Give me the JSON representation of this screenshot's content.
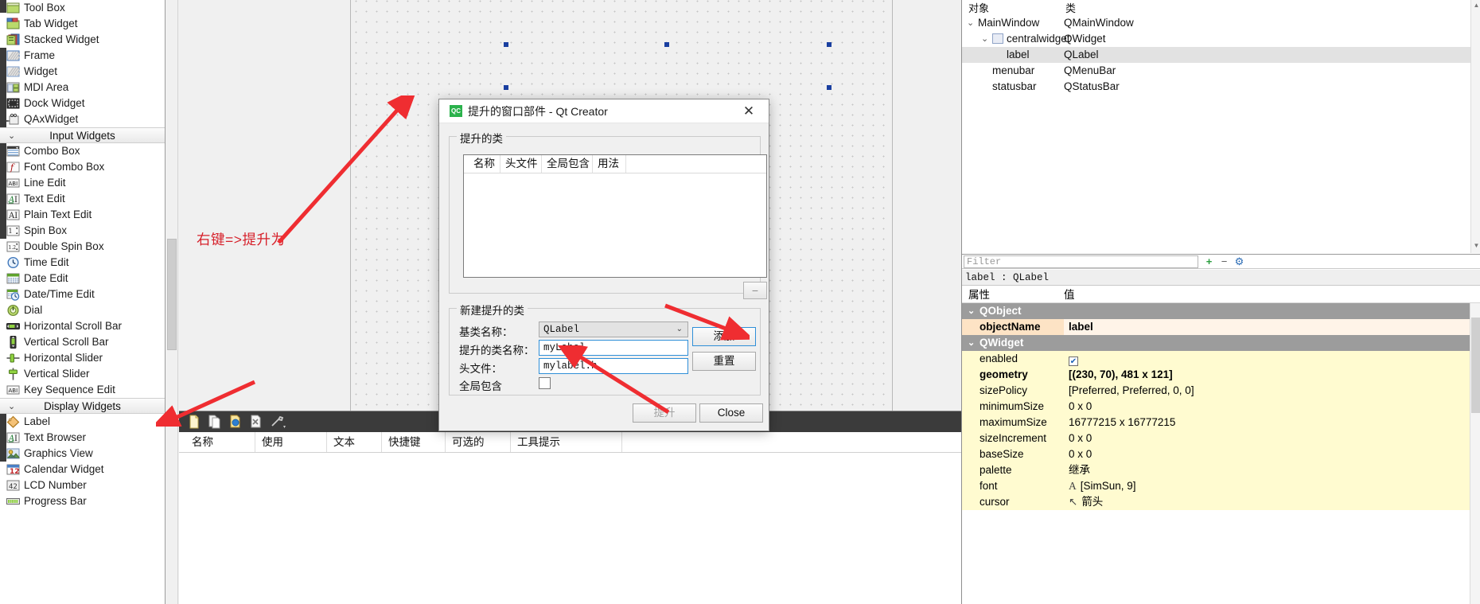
{
  "widget_box": {
    "groups": [
      {
        "items": [
          {
            "label": "Tool Box",
            "icon": "toolbox-icon"
          },
          {
            "label": "Tab Widget",
            "icon": "tabwidget-icon"
          },
          {
            "label": "Stacked Widget",
            "icon": "stackedwidget-icon"
          },
          {
            "label": "Frame",
            "icon": "frame-icon"
          },
          {
            "label": "Widget",
            "icon": "widget-icon"
          },
          {
            "label": "MDI Area",
            "icon": "mdiarea-icon"
          },
          {
            "label": "Dock Widget",
            "icon": "dockwidget-icon"
          },
          {
            "label": "QAxWidget",
            "icon": "qaxwidget-icon"
          }
        ]
      },
      {
        "title": "Input Widgets",
        "items": [
          {
            "label": "Combo Box",
            "icon": "combobox-icon"
          },
          {
            "label": "Font Combo Box",
            "icon": "fontcombobox-icon"
          },
          {
            "label": "Line Edit",
            "icon": "lineedit-icon"
          },
          {
            "label": "Text Edit",
            "icon": "textedit-icon"
          },
          {
            "label": "Plain Text Edit",
            "icon": "plaintextedit-icon"
          },
          {
            "label": "Spin Box",
            "icon": "spinbox-icon"
          },
          {
            "label": "Double Spin Box",
            "icon": "doublespinbox-icon"
          },
          {
            "label": "Time Edit",
            "icon": "timeedit-icon"
          },
          {
            "label": "Date Edit",
            "icon": "dateedit-icon"
          },
          {
            "label": "Date/Time Edit",
            "icon": "datetimeedit-icon"
          },
          {
            "label": "Dial",
            "icon": "dial-icon"
          },
          {
            "label": "Horizontal Scroll Bar",
            "icon": "hscrollbar-icon"
          },
          {
            "label": "Vertical Scroll Bar",
            "icon": "vscrollbar-icon"
          },
          {
            "label": "Horizontal Slider",
            "icon": "hslider-icon"
          },
          {
            "label": "Vertical Slider",
            "icon": "vslider-icon"
          },
          {
            "label": "Key Sequence Edit",
            "icon": "keysequenceedit-icon"
          }
        ]
      },
      {
        "title": "Display Widgets",
        "items": [
          {
            "label": "Label",
            "icon": "label-icon"
          },
          {
            "label": "Text Browser",
            "icon": "textbrowser-icon"
          },
          {
            "label": "Graphics View",
            "icon": "graphicsview-icon"
          },
          {
            "label": "Calendar Widget",
            "icon": "calendarwidget-icon"
          },
          {
            "label": "LCD Number",
            "icon": "lcdnumber-icon"
          },
          {
            "label": "Progress Bar",
            "icon": "progressbar-icon"
          }
        ]
      }
    ]
  },
  "annotations": {
    "hint_text": "右键=>提升为",
    "hint_color": "#d6202a"
  },
  "dialog": {
    "title": "提升的窗口部件 - Qt Creator",
    "app_icon_text": "QC",
    "close_label": "✕",
    "promoted_group": {
      "legend": "提升的类",
      "columns": [
        "名称",
        "头文件",
        "全局包含",
        "用法"
      ],
      "rows": [],
      "remove_button": "−"
    },
    "new_group": {
      "legend": "新建提升的类",
      "fields": [
        {
          "label": "基类名称：",
          "value": "QLabel",
          "type": "combo"
        },
        {
          "label": "提升的类名称：",
          "value": "myLabel",
          "type": "text"
        },
        {
          "label": "头文件：",
          "value": "mylabel.h",
          "type": "text"
        },
        {
          "label": "全局包含",
          "value": "",
          "type": "checkbox",
          "checked": false
        }
      ]
    },
    "buttons": {
      "add": "添加",
      "reset": "重置",
      "promote": "提升",
      "close": "Close"
    }
  },
  "action_editor": {
    "columns": [
      "名称",
      "使用",
      "文本",
      "快捷键",
      "可选的",
      "工具提示"
    ],
    "toolbar_icons": [
      "new-action-icon",
      "copy-action-icon",
      "edit-action-icon",
      "delete-action-icon",
      "configure-icon"
    ],
    "rows": []
  },
  "object_inspector": {
    "headers": [
      "对象",
      "类"
    ],
    "rows": [
      {
        "name": "MainWindow",
        "class": "QMainWindow",
        "indent": 0,
        "expanded": true,
        "selected": false,
        "has_icon": false
      },
      {
        "name": "centralwidget",
        "class": "QWidget",
        "indent": 1,
        "expanded": true,
        "selected": false,
        "has_icon": true
      },
      {
        "name": "label",
        "class": "QLabel",
        "indent": 2,
        "expanded": false,
        "selected": true,
        "has_icon": false
      },
      {
        "name": "menubar",
        "class": "QMenuBar",
        "indent": 1,
        "expanded": false,
        "selected": false,
        "has_icon": false
      },
      {
        "name": "statusbar",
        "class": "QStatusBar",
        "indent": 1,
        "expanded": false,
        "selected": false,
        "has_icon": false
      }
    ]
  },
  "property_editor": {
    "filter_placeholder": "Filter",
    "add_button": "+",
    "remove_button": "−",
    "config_button": "⚙",
    "object_line": "label : QLabel",
    "headers": [
      "属性",
      "值"
    ],
    "rows": [
      {
        "kind": "group",
        "key": "QObject",
        "value": "",
        "expanded": true
      },
      {
        "kind": "prop",
        "key": "objectName",
        "value": "label",
        "style": "orange",
        "bold": true,
        "expandable": false
      },
      {
        "kind": "group",
        "key": "QWidget",
        "value": "",
        "expanded": true
      },
      {
        "kind": "prop",
        "key": "enabled",
        "value": "",
        "style": "yellow",
        "bold": false,
        "expandable": false,
        "checkbox": true,
        "checked": true
      },
      {
        "kind": "prop",
        "key": "geometry",
        "value": "[(230, 70), 481 x 121]",
        "style": "yellow",
        "bold": true,
        "expandable": true
      },
      {
        "kind": "prop",
        "key": "sizePolicy",
        "value": "[Preferred, Preferred, 0, 0]",
        "style": "yellow",
        "bold": false,
        "expandable": true
      },
      {
        "kind": "prop",
        "key": "minimumSize",
        "value": "0 x 0",
        "style": "yellow",
        "bold": false,
        "expandable": true
      },
      {
        "kind": "prop",
        "key": "maximumSize",
        "value": "16777215 x 16777215",
        "style": "yellow",
        "bold": false,
        "expandable": true
      },
      {
        "kind": "prop",
        "key": "sizeIncrement",
        "value": "0 x 0",
        "style": "yellow",
        "bold": false,
        "expandable": true
      },
      {
        "kind": "prop",
        "key": "baseSize",
        "value": "0 x 0",
        "style": "yellow",
        "bold": false,
        "expandable": true
      },
      {
        "kind": "prop",
        "key": "palette",
        "value": "继承",
        "style": "yellow",
        "bold": false,
        "expandable": false
      },
      {
        "kind": "prop",
        "key": "font",
        "value": "[SimSun, 9]",
        "style": "yellow",
        "bold": false,
        "expandable": true,
        "prefix": "A"
      },
      {
        "kind": "prop",
        "key": "cursor",
        "value": "箭头",
        "style": "yellow",
        "bold": false,
        "expandable": false,
        "prefix": "↖"
      }
    ]
  }
}
